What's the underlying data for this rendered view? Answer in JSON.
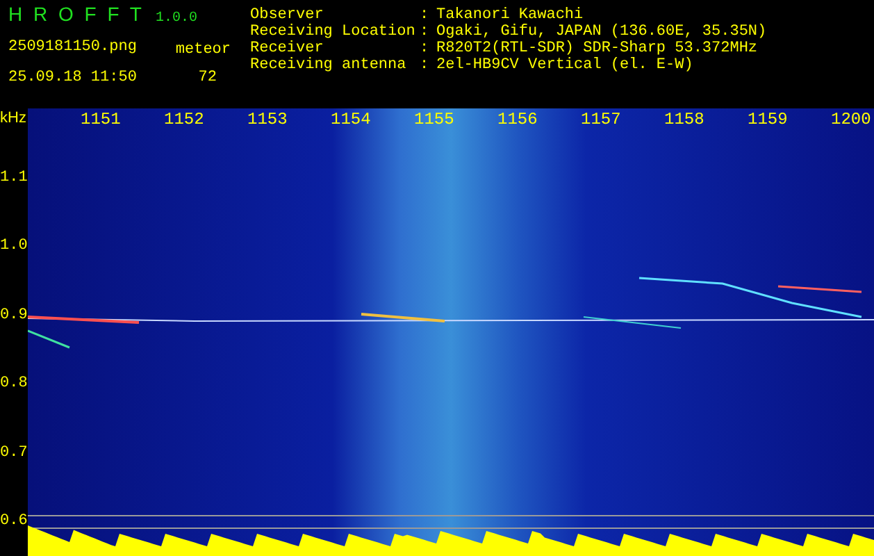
{
  "app": {
    "name": "H R O F F T",
    "version": "1.0.0"
  },
  "file": "2509181150.png",
  "timestamp": "25.09.18 11:50",
  "meteor": {
    "label": "meteor",
    "count": "72"
  },
  "info": [
    {
      "label": "Observer",
      "separator": ":",
      "value": "Takanori Kawachi"
    },
    {
      "label": "Receiving Location",
      "separator": ":",
      "value": "Ogaki, Gifu, JAPAN (136.60E, 35.35N)"
    },
    {
      "label": "Receiver",
      "separator": ":",
      "value": "R820T2(RTL-SDR) SDR-Sharp 53.372MHz"
    },
    {
      "label": "Receiving antenna",
      "separator": ":",
      "value": "2el-HB9CV Vertical (el. E-W)"
    }
  ],
  "spectrogram": {
    "unit": "kHz",
    "time_labels": [
      "1151",
      "1152",
      "1153",
      "1154",
      "1155",
      "1156",
      "1157",
      "1158",
      "1159",
      "1200"
    ],
    "freq_labels": [
      "1.1",
      "1.0",
      "0.9",
      "0.8",
      "0.7",
      "0.6"
    ]
  }
}
